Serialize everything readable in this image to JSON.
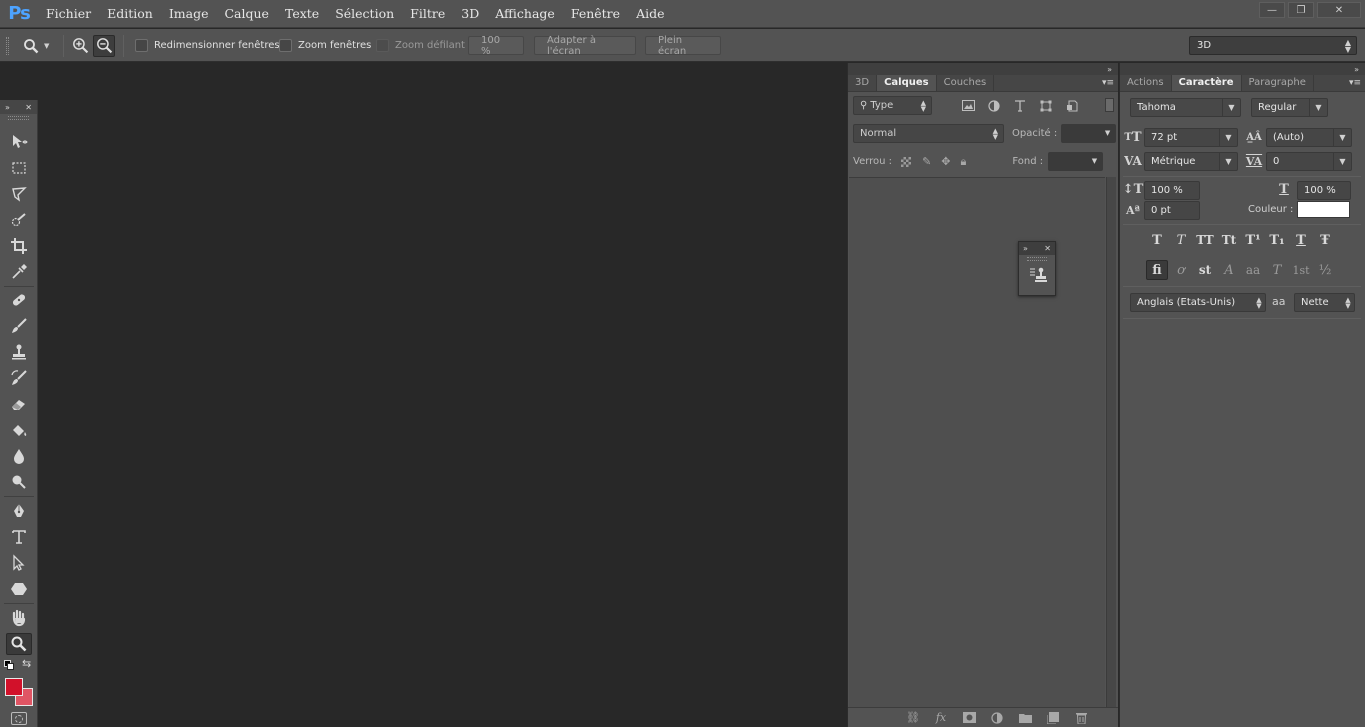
{
  "app": {
    "logo": "Ps",
    "menu": [
      "Fichier",
      "Edition",
      "Image",
      "Calque",
      "Texte",
      "Sélection",
      "Filtre",
      "3D",
      "Affichage",
      "Fenêtre",
      "Aide"
    ],
    "window_buttons": {
      "minimize": "—",
      "restore": "❐",
      "close": "✕"
    }
  },
  "options_bar": {
    "tool_icon": "zoom-icon",
    "zoom_in_icon": "zoom-in-icon",
    "zoom_out_icon": "zoom-out-icon",
    "resize_windows": {
      "label": "Redimensionner fenêtres",
      "checked": false
    },
    "zoom_windows": {
      "label": "Zoom fenêtres",
      "checked": false
    },
    "scrubby_zoom": {
      "label": "Zoom défilant",
      "checked": false,
      "disabled": true
    },
    "zoom_100_label": "100 %",
    "fit_screen_label": "Adapter à l'écran",
    "fill_screen_label": "Plein écran",
    "workspace": "3D"
  },
  "toolbar": {
    "collapse": "»",
    "close": "✕",
    "tools": [
      "move-icon",
      "marquee-icon",
      "lasso-icon",
      "quick-select-icon",
      "crop-icon",
      "eyedropper-icon",
      "healing-icon",
      "brush-icon",
      "stamp-icon",
      "history-brush-icon",
      "eraser-icon",
      "paint-bucket-icon",
      "blur-icon",
      "dodge-icon",
      "pen-icon",
      "type-icon",
      "path-select-icon",
      "shape-icon",
      "hand-icon",
      "zoom-icon"
    ],
    "active_tool": "zoom-icon",
    "foreground_color": "#d2112a",
    "background_color": "#e05564"
  },
  "layers_panel": {
    "tabs": [
      "3D",
      "Calques",
      "Couches"
    ],
    "active_tab": "Calques",
    "filter_kind": "Type",
    "blend_mode": "Normal",
    "opacity_label": "Opacité :",
    "opacity_value": "",
    "lock_label": "Verrou :",
    "fill_label": "Fond :",
    "fill_value": "",
    "footer_icons": [
      "link-icon",
      "fx-icon",
      "mask-icon",
      "adjustment-icon",
      "folder-icon",
      "new-layer-icon",
      "trash-icon"
    ]
  },
  "character_panel": {
    "tabs": [
      "Actions",
      "Caractère",
      "Paragraphe"
    ],
    "active_tab": "Caractère",
    "font_family": "Tahoma",
    "font_style": "Regular",
    "font_size": "72 pt",
    "leading": "(Auto)",
    "kerning": "Métrique",
    "tracking": "0",
    "vertical_scale": "100 %",
    "horizontal_scale": "100 %",
    "baseline_shift": "0 pt",
    "color_label": "Couleur :",
    "text_color": "#ffffff",
    "style_buttons": [
      "T",
      "T",
      "TT",
      "Tt",
      "T¹",
      "T₁",
      "T",
      "Ŧ"
    ],
    "opentype_buttons": [
      "ﬁ",
      "ơ",
      "st",
      "A",
      "aa",
      "T",
      "1st",
      "½"
    ],
    "language": "Anglais (Etats-Unis)",
    "antialias_icon": "aa",
    "antialias": "Nette"
  }
}
